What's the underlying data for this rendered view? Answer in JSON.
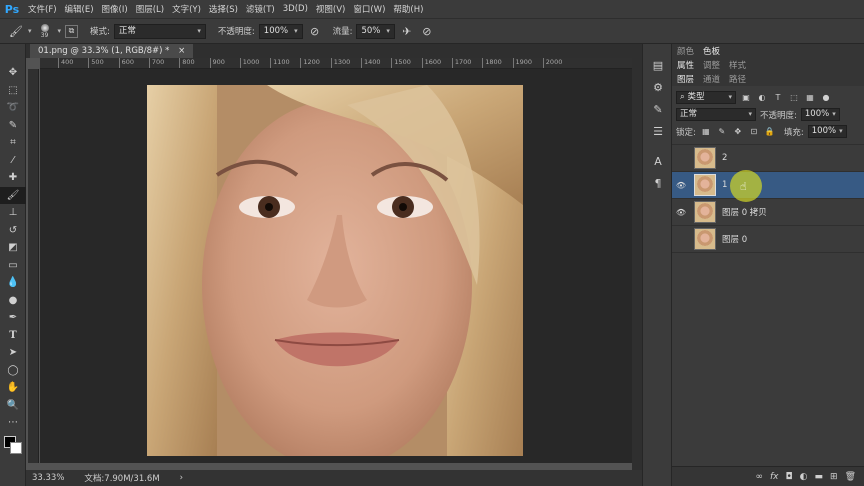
{
  "app": {
    "logo": "Ps"
  },
  "menu": [
    "文件(F)",
    "编辑(E)",
    "图像(I)",
    "图层(L)",
    "文字(Y)",
    "选择(S)",
    "滤镜(T)",
    "3D(D)",
    "视图(V)",
    "窗口(W)",
    "帮助(H)"
  ],
  "options": {
    "brush_size": "39",
    "mode_label": "模式:",
    "mode_value": "正常",
    "opacity_label": "不透明度:",
    "opacity_value": "100%",
    "flow_label": "流量:",
    "flow_value": "50%"
  },
  "document": {
    "tab_title": "01.png @ 33.3% (1, RGB/8#) *",
    "ruler_ticks": [
      "400",
      "500",
      "600",
      "700",
      "800",
      "900",
      "1000",
      "1100",
      "1200",
      "1300",
      "1400",
      "1500",
      "1600",
      "1700",
      "1800",
      "1900",
      "2000"
    ]
  },
  "status": {
    "zoom": "33.33%",
    "doc_info": "文档:7.90M/31.6M"
  },
  "panels": {
    "top_tabs": [
      "颜色",
      "色板"
    ],
    "mid_tabs": [
      "属性",
      "调整",
      "样式"
    ],
    "layers_tabs": [
      "图层",
      "通道",
      "路径"
    ],
    "filter_kind": "类型",
    "blend_mode": "正常",
    "opacity_label": "不透明度:",
    "opacity_value": "100%",
    "lock_label": "锁定:",
    "fill_label": "填充:",
    "fill_value": "100%"
  },
  "layers": [
    {
      "name": "2",
      "visible": false,
      "selected": false
    },
    {
      "name": "1",
      "visible": true,
      "selected": true
    },
    {
      "name": "图层 0 拷贝",
      "visible": true,
      "selected": false
    },
    {
      "name": "图层 0",
      "visible": false,
      "selected": false
    }
  ],
  "colors": {
    "accent": "#31a8ff",
    "selection": "#375a84"
  }
}
